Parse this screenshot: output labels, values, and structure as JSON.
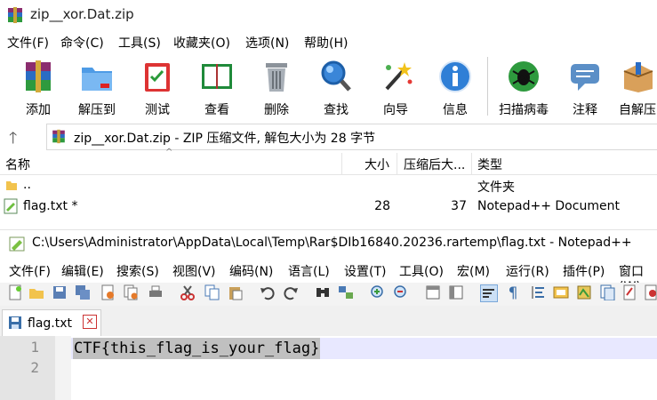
{
  "winrar": {
    "title": "zip__xor.Dat.zip",
    "menu": [
      "文件(F)",
      "命令(C)",
      "工具(S)",
      "收藏夹(O)",
      "选项(N)",
      "帮助(H)"
    ],
    "toolbar": [
      {
        "label": "添加",
        "icon": "archive-add-icon"
      },
      {
        "label": "解压到",
        "icon": "extract-folder-icon"
      },
      {
        "label": "测试",
        "icon": "test-clipboard-icon"
      },
      {
        "label": "查看",
        "icon": "view-book-icon"
      },
      {
        "label": "删除",
        "icon": "trash-icon"
      },
      {
        "label": "查找",
        "icon": "find-magnifier-icon"
      },
      {
        "label": "向导",
        "icon": "wizard-wand-icon"
      },
      {
        "label": "信息",
        "icon": "info-icon"
      },
      {
        "label": "扫描病毒",
        "icon": "virus-scan-icon"
      },
      {
        "label": "注释",
        "icon": "comment-icon"
      },
      {
        "label": "自解压",
        "icon": "sfx-box-icon"
      }
    ],
    "path_text": "zip__xor.Dat.zip - ZIP 压缩文件, 解包大小为 28 字节",
    "columns": {
      "name": "名称",
      "size": "大小",
      "packed": "压缩后大...",
      "type": "类型"
    },
    "rows": [
      {
        "name": "..",
        "size": "",
        "packed": "",
        "type": "文件夹"
      },
      {
        "name": "flag.txt *",
        "size": "28",
        "packed": "37",
        "type": "Notepad++ Document"
      }
    ]
  },
  "npp": {
    "title": "C:\\Users\\Administrator\\AppData\\Local\\Temp\\Rar$DIb16840.20236.rartemp\\flag.txt - Notepad++",
    "menu": [
      "文件(F)",
      "编辑(E)",
      "搜索(S)",
      "视图(V)",
      "编码(N)",
      "语言(L)",
      "设置(T)",
      "工具(O)",
      "宏(M)",
      "运行(R)",
      "插件(P)",
      "窗口(W)"
    ],
    "tab_label": "flag.txt",
    "tab_close": "✕",
    "line_numbers": [
      "1",
      "2"
    ],
    "lines": [
      "CTF{this_flag_is_your_flag}"
    ]
  },
  "colors": {
    "accent": "#0078d7",
    "selection": "#c0c0c0",
    "current_line": "#e8e8ff"
  }
}
